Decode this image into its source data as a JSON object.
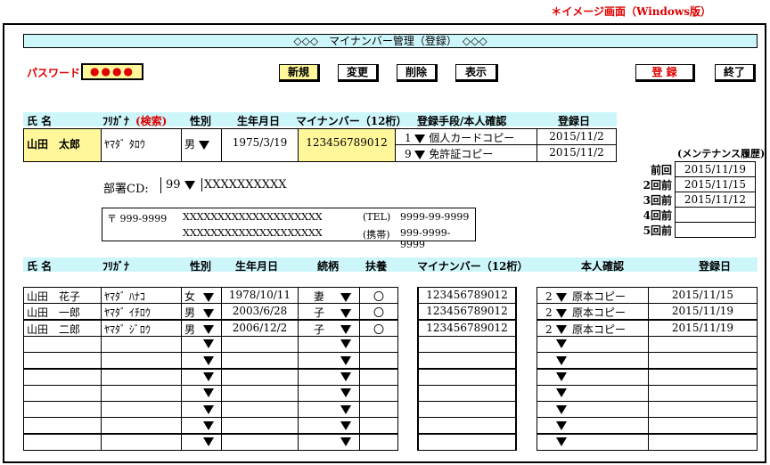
{
  "note": "＊イメージ画面（Windows版）",
  "title": "◇◇◇　マイナンバー管理（登録）　◇◇◇",
  "password": {
    "label": "パスワード",
    "value": "●●●●"
  },
  "buttons": {
    "new": "新規",
    "change": "変更",
    "delete": "削除",
    "display": "表示",
    "register": "登 録",
    "end": "終了"
  },
  "main_header": {
    "name": "氏 名",
    "kana": "ﾌﾘｶﾞﾅ",
    "search": "(検索)",
    "gender": "性別",
    "birth": "生年月日",
    "mynumber": "マイナンバー（12桁）",
    "method": "登録手段/本人確認",
    "regdate": "登録日"
  },
  "main_record": {
    "name": "山田　太郎",
    "kana": "ﾔﾏﾀﾞ ﾀﾛｳ",
    "gender": "男",
    "birth": "1975/3/19",
    "mynumber": "123456789012",
    "methods": [
      {
        "code": "1",
        "label": "個人カードコピー",
        "date": "2015/11/2"
      },
      {
        "code": "9",
        "label": "免許証コピー",
        "date": "2015/11/2"
      }
    ]
  },
  "maintenance": {
    "title": "(メンテナンス履歴)",
    "rows": [
      {
        "label": "前回",
        "date": "2015/11/19"
      },
      {
        "label": "2回前",
        "date": "2015/11/15"
      },
      {
        "label": "3回前",
        "date": "2015/11/12"
      },
      {
        "label": "4回前",
        "date": ""
      },
      {
        "label": "5回前",
        "date": ""
      }
    ]
  },
  "dept": {
    "label": "部署CD:",
    "code": "99",
    "name": "XXXXXXXXXX"
  },
  "address": {
    "zip": "〒 999-9999",
    "line1": "XXXXXXXXXXXXXXXXXXXX",
    "line2": "XXXXXXXXXXXXXXXXXXXX",
    "tel_label": "(TEL)",
    "tel": "9999-99-9999",
    "mobile_label": "(携帯)",
    "mobile": "999-9999-9999"
  },
  "family_header": {
    "name": "氏 名",
    "kana": "ﾌﾘｶﾞﾅ",
    "gender": "性別",
    "birth": "生年月日",
    "relation": "続柄",
    "dependent": "扶養",
    "mynumber": "マイナンバー（12桁）",
    "identity": "本人確認",
    "regdate": "登録日"
  },
  "family": [
    {
      "name": "山田　花子",
      "kana": "ﾔﾏﾀﾞ ﾊﾅｺ",
      "gender": "女",
      "birth": "1978/10/11",
      "relation": "妻",
      "dependent": "〇",
      "mynumber": "123456789012",
      "code": "2",
      "identity": "原本コピー",
      "date": "2015/11/15"
    },
    {
      "name": "山田　一郎",
      "kana": "ﾔﾏﾀﾞ ｲﾁﾛｳ",
      "gender": "男",
      "birth": "2003/6/28",
      "relation": "子",
      "dependent": "〇",
      "mynumber": "123456789012",
      "code": "2",
      "identity": "原本コピー",
      "date": "2015/11/19"
    },
    {
      "name": "山田　二郎",
      "kana": "ﾔﾏﾀﾞ ｼﾞﾛｳ",
      "gender": "男",
      "birth": "2006/12/2",
      "relation": "子",
      "dependent": "〇",
      "mynumber": "123456789012",
      "code": "2",
      "identity": "原本コピー",
      "date": "2015/11/19"
    },
    {},
    {},
    {},
    {},
    {},
    {},
    {}
  ]
}
